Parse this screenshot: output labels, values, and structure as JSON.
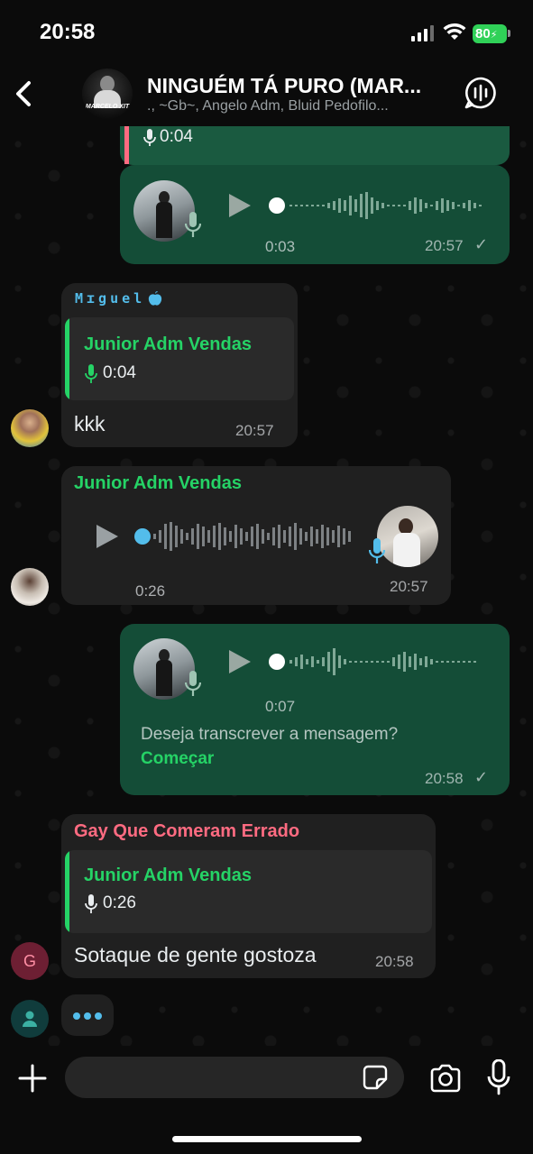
{
  "status_bar": {
    "time": "20:58",
    "battery": "80"
  },
  "header": {
    "group_name": "NINGUÉM TÁ PURO (MAR...",
    "members": "., ~Gb~, Angelo Adm, Bluid Pedofilo...",
    "avatar_label": "MARCELO XIT"
  },
  "messages": {
    "m1": {
      "quote_duration": "0:04"
    },
    "m2": {
      "duration": "0:03",
      "time": "20:57"
    },
    "m3": {
      "sender": "Mɪguel",
      "quote_name": "Junior Adm Vendas",
      "quote_duration": "0:04",
      "text": "kkk",
      "time": "20:57"
    },
    "m4": {
      "sender": "Junior Adm Vendas",
      "duration": "0:26",
      "time": "20:57"
    },
    "m5": {
      "duration": "0:07",
      "transcribe_prompt": "Deseja transcrever a mensagem?",
      "transcribe_action": "Começar",
      "time": "20:58"
    },
    "m6": {
      "sender": "Gay Que Comeram Errado",
      "quote_name": "Junior Adm Vendas",
      "quote_duration": "0:26",
      "text": "Sotaque de gente gostoza",
      "time": "20:58",
      "avatar_initial": "G"
    }
  },
  "input": {
    "placeholder": ""
  },
  "colors": {
    "outgoing": "#144d37",
    "incoming": "#202020",
    "accent": "#25d366",
    "pink_sender": "#ff6b81",
    "blue_sender": "#53bdeb",
    "battery": "#30d158"
  }
}
